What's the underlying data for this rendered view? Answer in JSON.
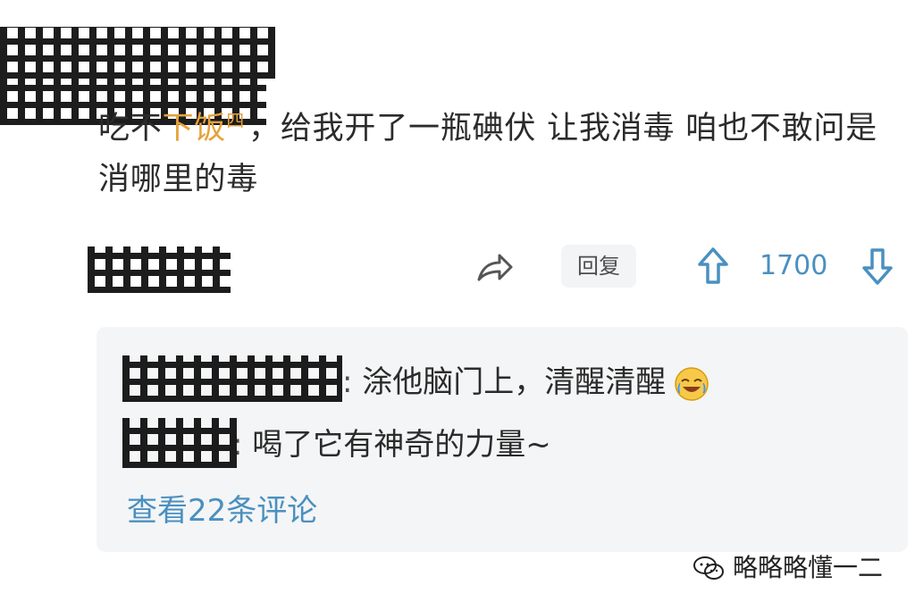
{
  "post": {
    "header_masked": "",
    "comment": {
      "prefix": "吃不",
      "tag": "下饭",
      "text": "，给我开了一瓶碘伏 让我消毒 咱也不敢问是消哪里的毒",
      "tag_icon": "四",
      "user_masked": ""
    },
    "actions": {
      "reply_label": "回复",
      "vote_count": "1700",
      "share_icon": "share-icon",
      "upvote_icon": "up-arrow-icon",
      "downvote_icon": "down-arrow-icon"
    },
    "replies": [
      {
        "author_masked": "",
        "separator": ": ",
        "text": "涂他脑门上，清醒清醒",
        "emoji": "laughing-crying-emoji"
      },
      {
        "author_masked": "",
        "separator": ": ",
        "text": "喝了它有神奇的力量~"
      }
    ],
    "view_more_label": "查看22条评论"
  },
  "watermark": {
    "label": "略略略懂一二",
    "icon": "wechat-icon"
  },
  "colors": {
    "accent": "#4a90c0",
    "tag": "#e6a23c",
    "panel": "#f4f5f6"
  }
}
